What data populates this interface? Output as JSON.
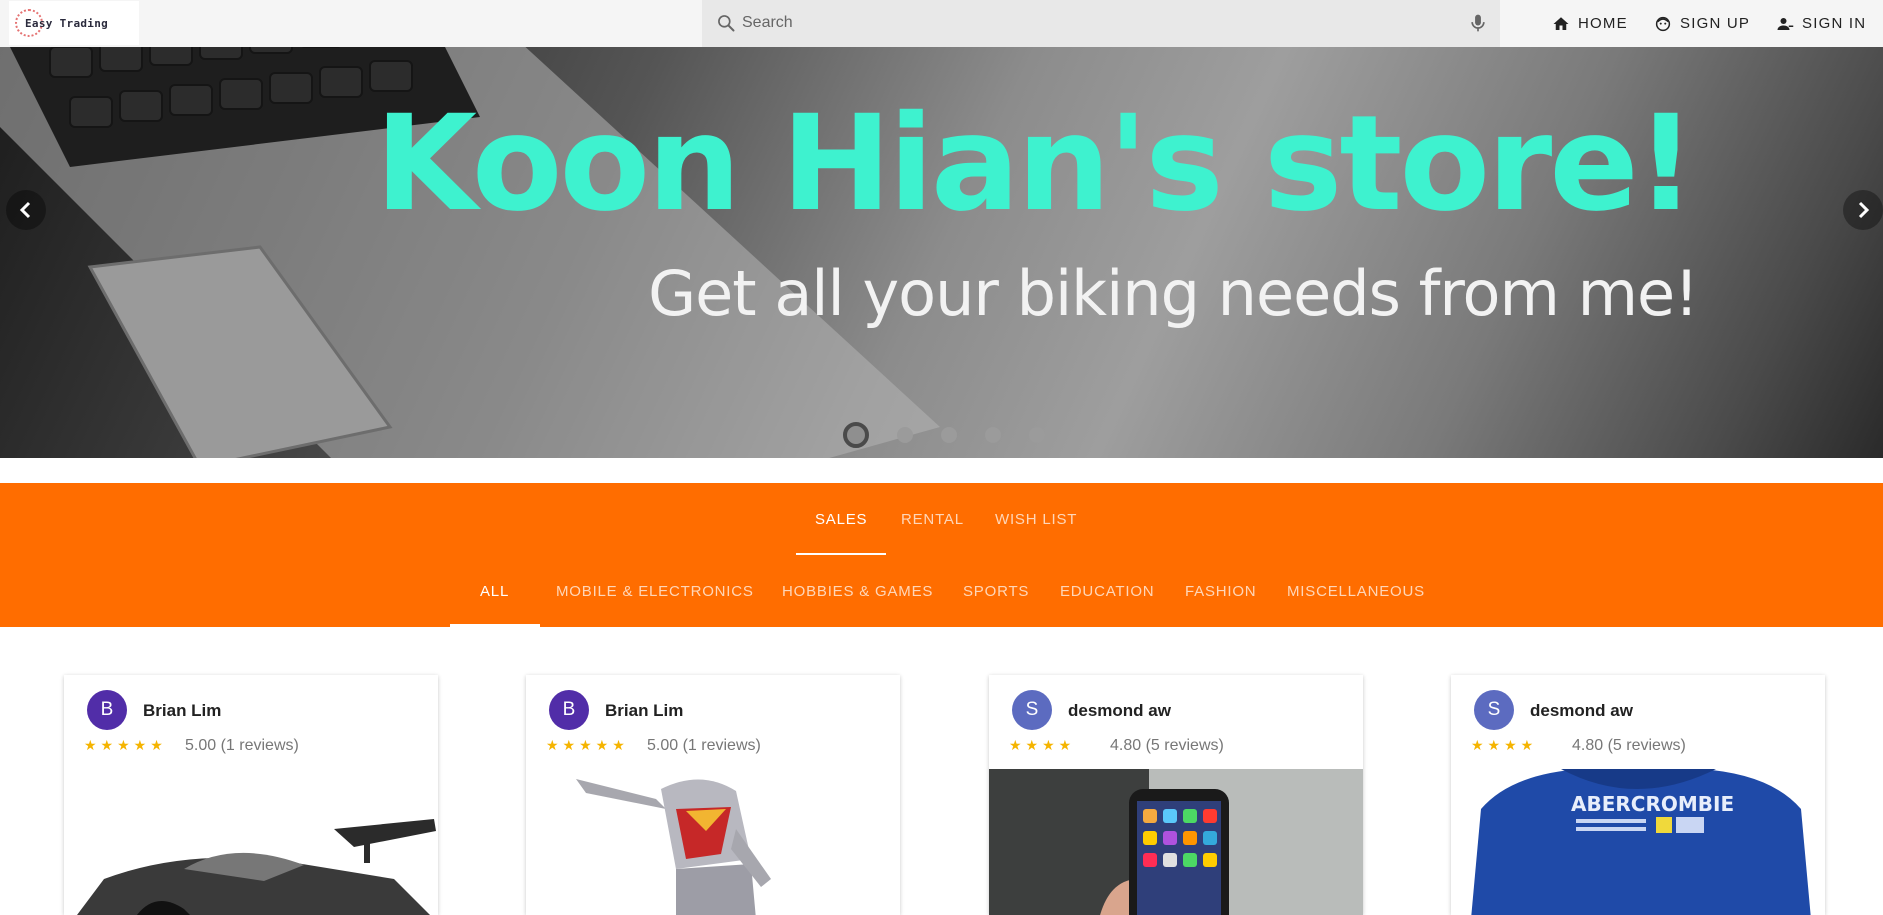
{
  "header": {
    "logo_text": "Easy Trading",
    "search_placeholder": "Search",
    "nav": [
      {
        "label": "HOME",
        "icon": "home-icon"
      },
      {
        "label": "SIGN UP",
        "icon": "face-icon"
      },
      {
        "label": "SIGN IN",
        "icon": "person-add-icon"
      }
    ]
  },
  "hero": {
    "title": "Koon Hian's store!",
    "subtitle": "Get all your biking needs from me!",
    "slide_count": 5,
    "active_slide": 1
  },
  "tabs": {
    "primary": [
      "SALES",
      "RENTAL",
      "WISH LIST"
    ],
    "primary_active": "SALES",
    "categories": [
      "ALL",
      "MOBILE & ELECTRONICS",
      "HOBBIES & GAMES",
      "SPORTS",
      "EDUCATION",
      "FASHION",
      "MISCELLANEOUS"
    ],
    "category_active": "ALL"
  },
  "listings": [
    {
      "avatar_letter": "B",
      "avatar_color": "#512da8",
      "seller": "Brian Lim",
      "stars": "★★★★★",
      "rating": "5.00 (1 reviews)",
      "image": "toy-car"
    },
    {
      "avatar_letter": "B",
      "avatar_color": "#512da8",
      "seller": "Brian Lim",
      "stars": "★★★★★",
      "rating": "5.00 (1 reviews)",
      "image": "action-figure"
    },
    {
      "avatar_letter": "S",
      "avatar_color": "#5c6bc0",
      "seller": "desmond aw",
      "stars": "★★★★",
      "rating": "4.80 (5 reviews)",
      "image": "smartphone"
    },
    {
      "avatar_letter": "S",
      "avatar_color": "#5c6bc0",
      "seller": "desmond aw",
      "stars": "★★★★",
      "rating": "4.80 (5 reviews)",
      "image": "hoodie"
    }
  ],
  "colors": {
    "accent": "#ff6d00",
    "hero_title": "#3ef2cf",
    "star": "#f5b400"
  }
}
